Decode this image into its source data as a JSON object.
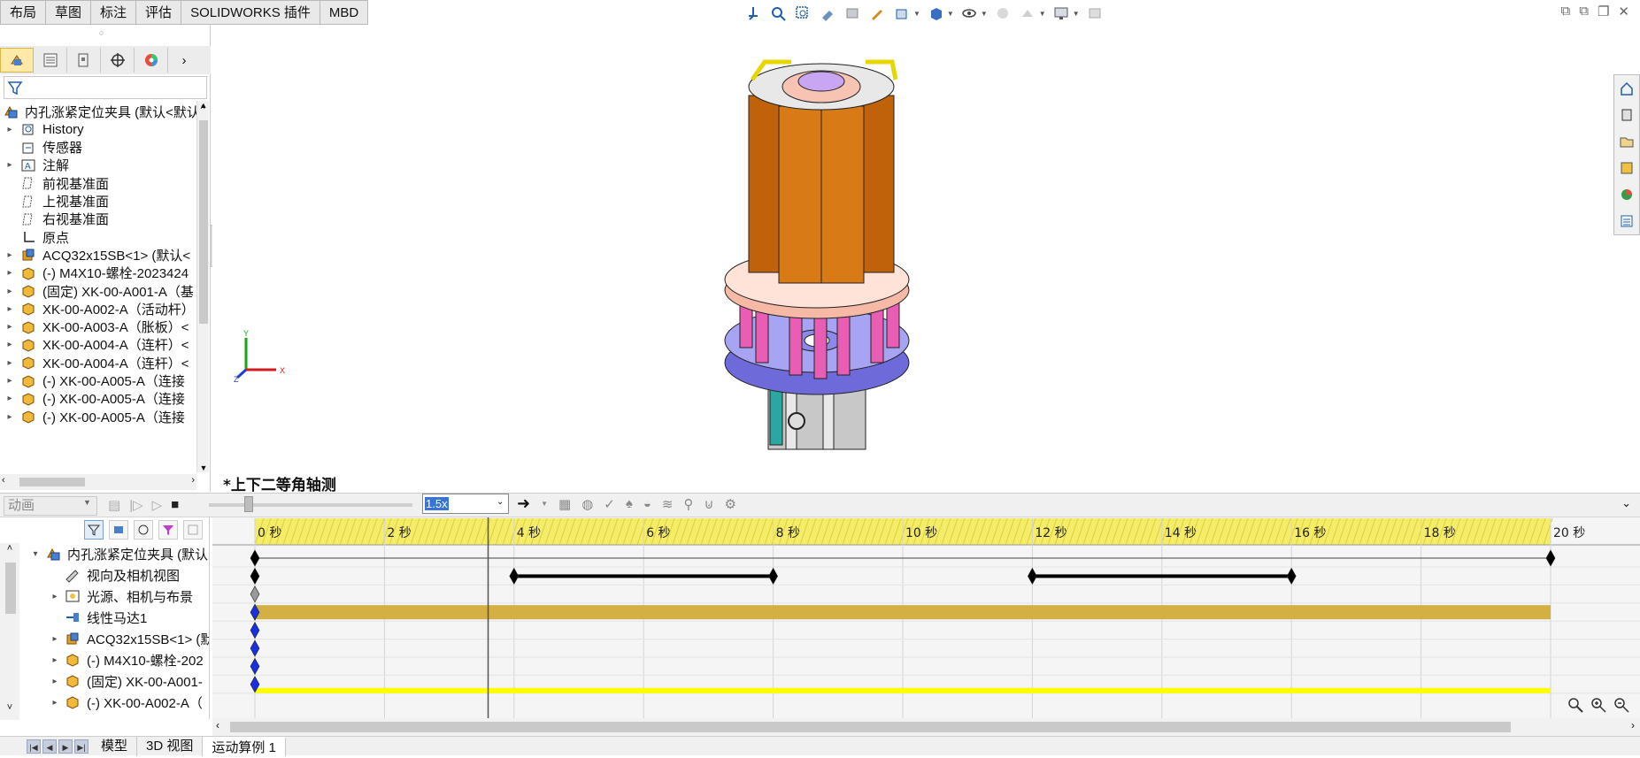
{
  "command_tabs": [
    "布局",
    "草图",
    "标注",
    "评估",
    "SOLIDWORKS 插件",
    "MBD"
  ],
  "feature_manager": {
    "manager_tabs": [
      "feature-manager",
      "property-manager",
      "configuration-manager",
      "dimxpert-manager",
      "display-manager"
    ],
    "tree": [
      {
        "label": "内孔涨紧定位夹具 (默认<默认",
        "icon": "assembly-icon",
        "expand": false,
        "indent": 0
      },
      {
        "label": "History",
        "icon": "history-icon",
        "expand": true,
        "indent": 1
      },
      {
        "label": "传感器",
        "icon": "sensor-icon",
        "expand": false,
        "indent": 1
      },
      {
        "label": "注解",
        "icon": "annotation-icon",
        "expand": true,
        "indent": 1
      },
      {
        "label": "前视基准面",
        "icon": "plane-icon",
        "expand": false,
        "indent": 1
      },
      {
        "label": "上视基准面",
        "icon": "plane-icon",
        "expand": false,
        "indent": 1
      },
      {
        "label": "右视基准面",
        "icon": "plane-icon",
        "expand": false,
        "indent": 1
      },
      {
        "label": "原点",
        "icon": "origin-icon",
        "expand": false,
        "indent": 1
      },
      {
        "label": "ACQ32x15SB<1> (默认<",
        "icon": "subassembly-icon",
        "expand": true,
        "indent": 1
      },
      {
        "label": "(-) M4X10-螺栓-2023424",
        "icon": "part-icon",
        "expand": true,
        "indent": 1
      },
      {
        "label": "(固定) XK-00-A001-A（基",
        "icon": "part-icon",
        "expand": true,
        "indent": 1
      },
      {
        "label": "XK-00-A002-A（活动杆）",
        "icon": "part-icon",
        "expand": true,
        "indent": 1
      },
      {
        "label": "XK-00-A003-A（胀板）<",
        "icon": "part-icon",
        "expand": true,
        "indent": 1
      },
      {
        "label": "XK-00-A004-A（连杆）<",
        "icon": "part-icon",
        "expand": true,
        "indent": 1
      },
      {
        "label": "XK-00-A004-A（连杆）<",
        "icon": "part-icon",
        "expand": true,
        "indent": 1
      },
      {
        "label": "(-) XK-00-A005-A（连接",
        "icon": "part-icon",
        "expand": true,
        "indent": 1
      },
      {
        "label": "(-) XK-00-A005-A（连接",
        "icon": "part-icon",
        "expand": true,
        "indent": 1
      },
      {
        "label": "(-) XK-00-A005-A（连接",
        "icon": "part-icon",
        "expand": true,
        "indent": 1
      }
    ]
  },
  "viewport": {
    "view_label": "*上下二等角轴测",
    "triad": {
      "x": "X",
      "y": "Y",
      "z": "Z"
    }
  },
  "animation": {
    "study_type": "动画",
    "speed": "1.5x",
    "time_ticks": [
      "0 秒",
      "2 秒",
      "4 秒",
      "6 秒",
      "8 秒",
      "10 秒",
      "12 秒",
      "14 秒",
      "16 秒",
      "18 秒",
      "20 秒"
    ],
    "duration_seconds": 20,
    "current_time_seconds": 3.6,
    "motion_tree": [
      {
        "label": "内孔涨紧定位夹具 (默认",
        "icon": "assembly-icon",
        "expand": "open",
        "indent": 0
      },
      {
        "label": "视向及相机视图",
        "icon": "camera-icon",
        "expand": "none",
        "indent": 1
      },
      {
        "label": "光源、相机与布景",
        "icon": "lights-icon",
        "expand": "closed",
        "indent": 1
      },
      {
        "label": "线性马达1",
        "icon": "motor-icon",
        "expand": "none",
        "indent": 1
      },
      {
        "label": "ACQ32x15SB<1> (默",
        "icon": "subassembly-icon",
        "expand": "closed",
        "indent": 1
      },
      {
        "label": "(-) M4X10-螺栓-202",
        "icon": "part-icon",
        "expand": "closed",
        "indent": 1
      },
      {
        "label": "(固定) XK-00-A001-",
        "icon": "part-icon",
        "expand": "closed",
        "indent": 1
      },
      {
        "label": "(-) XK-00-A002-A（",
        "icon": "part-icon",
        "expand": "closed",
        "indent": 1
      }
    ],
    "tracks": [
      {
        "row": 0,
        "keys": [
          0,
          20
        ],
        "bars": []
      },
      {
        "row": 1,
        "keys": [
          0,
          4,
          8,
          12,
          16
        ],
        "bars": [
          [
            4,
            8
          ],
          [
            12,
            16
          ]
        ]
      },
      {
        "row": 2,
        "keys": [
          0
        ],
        "bars": [],
        "key_color": "#9a9a9a"
      },
      {
        "row": 3,
        "keys": [
          0
        ],
        "bars": [],
        "band": [
          0,
          20
        ],
        "band_color": "#d4b044"
      },
      {
        "row": 4,
        "keys": [
          0
        ],
        "bars": []
      },
      {
        "row": 5,
        "keys": [
          0
        ],
        "bars": []
      },
      {
        "row": 6,
        "keys": [
          0
        ],
        "bars": []
      },
      {
        "row": 7,
        "keys": [
          0
        ],
        "bars": [],
        "line": [
          0,
          20
        ],
        "line_color": "#ffff00"
      }
    ],
    "colors": {
      "ruler_band": "#f5ec6a",
      "key_blue": "#1a2fe0",
      "key_black": "#000000"
    }
  },
  "bottom_tabs": [
    "模型",
    "3D 视图",
    "运动算例 1"
  ],
  "active_bottom_tab": "运动算例 1"
}
